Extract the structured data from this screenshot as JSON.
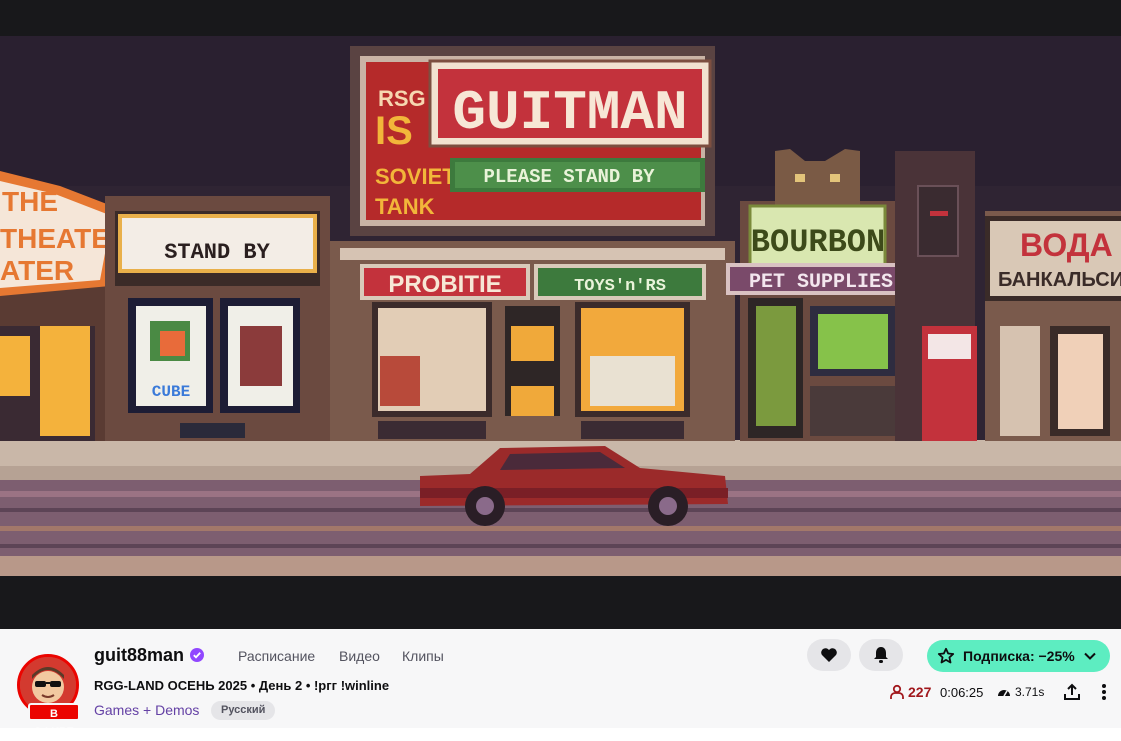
{
  "stream": {
    "scene_signs": {
      "top_sign_title": "GUITMAN",
      "top_sign_banner": "PLEASE STAND BY",
      "top_sign_side": [
        "RSG",
        "IS",
        "SOVIET",
        "TANK"
      ],
      "theater_sign": [
        "THE",
        "THEATER",
        "ATER"
      ],
      "marquee": "STAND BY",
      "poster_cube": "CUBE",
      "shop_left": "PROBITIE",
      "shop_right": "TOYS'n'RS",
      "bourbon": "BOURBON",
      "pet_supplies": "PET SUPPLIES",
      "right_sign_1": "ВОДА",
      "right_sign_2": "БАНКАЛЬСИ"
    }
  },
  "channel": {
    "name": "guit88man",
    "live_label": "В ЭФИРЕ",
    "title": "RGG-LAND ОСЕНЬ 2025 • День 2 • !ргг !winline",
    "category": "Games + Demos",
    "tag": "Русский"
  },
  "nav": {
    "schedule": "Расписание",
    "videos": "Видео",
    "clips": "Клипы"
  },
  "actions": {
    "subscribe_label": "Подписка: −25%"
  },
  "stats": {
    "viewers": "227",
    "uptime": "0:06:25",
    "latency": "3.71s"
  },
  "colors": {
    "accent_purple": "#6441a5",
    "live_red": "#eb0400",
    "subscribe_mint": "#5dedc1",
    "viewer_red": "#a1181d"
  }
}
